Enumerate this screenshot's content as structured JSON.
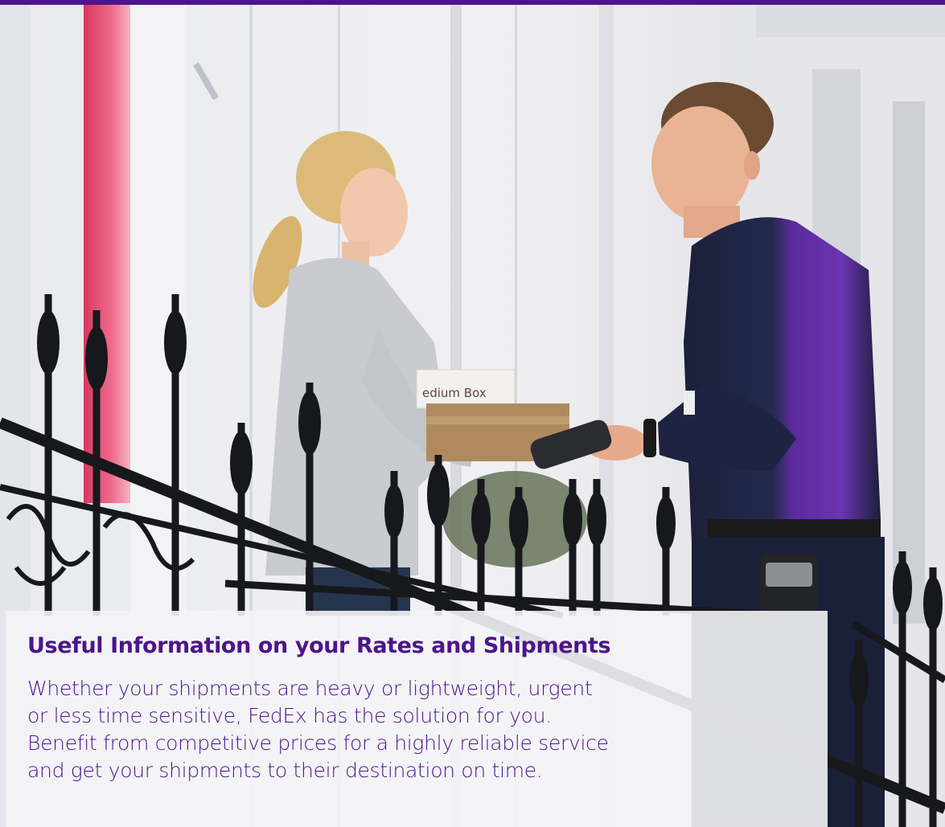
{
  "hero": {
    "image_description_icon": "delivery-photo",
    "colors": {
      "brand_purple": "#4d148c",
      "background": "#ecedf0"
    }
  },
  "info": {
    "title": "Useful Information on your Rates and Shipments",
    "body_lines": [
      "Whether your shipments are heavy or lightweight, urgent",
      "or less time sensitive, FedEx has the solution for you.",
      "Benefit from competitive prices for a highly reliable service",
      "and get your shipments to their destination on time."
    ]
  }
}
